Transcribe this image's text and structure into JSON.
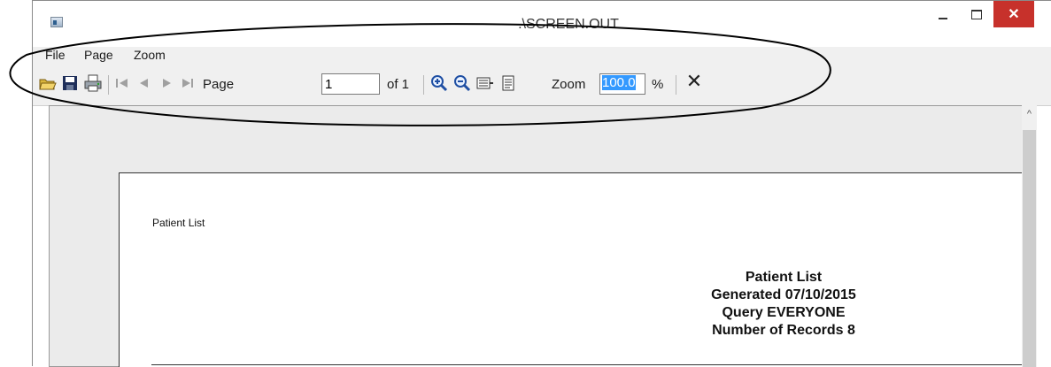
{
  "window": {
    "title": ".\\SCREEN.OUT",
    "close_glyph": "✕"
  },
  "menu": [
    "File",
    "Page",
    "Zoom"
  ],
  "toolbar": {
    "page_label": "Page",
    "page_value": "1",
    "of_label": "of 1",
    "zoom_label": "Zoom",
    "zoom_value": "100.0",
    "percent_label": "%",
    "close_glyph": "✕"
  },
  "report": {
    "small_title": "Patient List",
    "header_lines": [
      "Patient List",
      "Generated 07/10/2015",
      "Query EVERYONE",
      "Number of Records 8"
    ]
  },
  "colors": {
    "close_button": "#c7312b",
    "selection": "#3399ff",
    "chrome": "#f0f0f0"
  }
}
